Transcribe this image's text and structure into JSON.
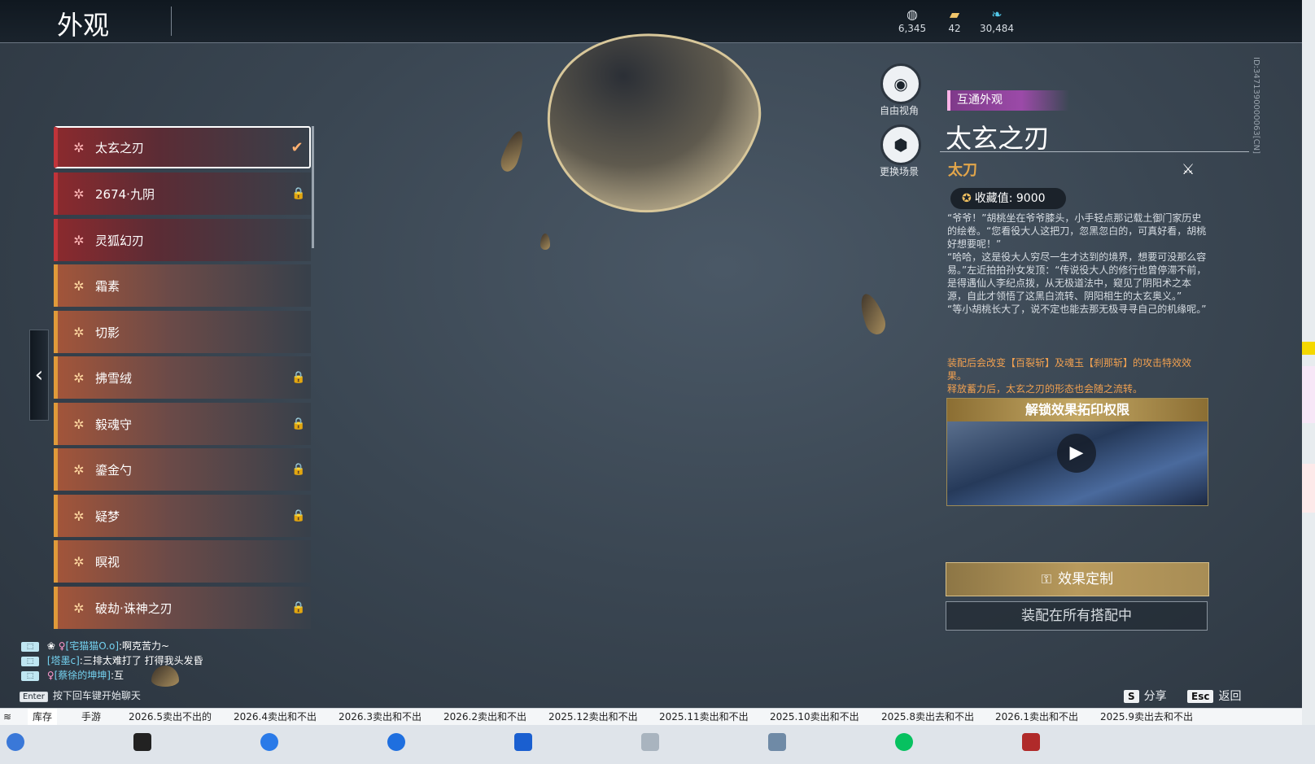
{
  "header": {
    "title": "外观",
    "currencies": [
      {
        "icon": "token-icon",
        "value": "6,345"
      },
      {
        "icon": "ticket-icon",
        "value": "42"
      },
      {
        "icon": "feather-icon",
        "value": "30,484"
      }
    ]
  },
  "list": {
    "items": [
      {
        "label": "太玄之刃",
        "rarity": "red",
        "selected": true,
        "locked": false
      },
      {
        "label": "2674·九阴",
        "rarity": "red",
        "selected": false,
        "locked": true
      },
      {
        "label": "灵狐幻刃",
        "rarity": "red",
        "selected": false,
        "locked": false
      },
      {
        "label": "霜素",
        "rarity": "orange",
        "selected": false,
        "locked": false
      },
      {
        "label": "切影",
        "rarity": "orange",
        "selected": false,
        "locked": false
      },
      {
        "label": "拂雪绒",
        "rarity": "orange",
        "selected": false,
        "locked": true
      },
      {
        "label": "毅魂守",
        "rarity": "orange",
        "selected": false,
        "locked": true
      },
      {
        "label": "鎏金勺",
        "rarity": "orange",
        "selected": false,
        "locked": true
      },
      {
        "label": "疑梦",
        "rarity": "orange",
        "selected": false,
        "locked": true
      },
      {
        "label": "瞑视",
        "rarity": "orange",
        "selected": false,
        "locked": false
      },
      {
        "label": "破劫·诛神之刃",
        "rarity": "orange",
        "selected": false,
        "locked": true
      }
    ]
  },
  "camera": {
    "free_view": "自由视角",
    "change_scene": "更换场景"
  },
  "detail": {
    "tag": "互通外观",
    "name": "太玄之刃",
    "weapon_type": "太刀",
    "collect_label": "收藏值: 9000",
    "description": "“爷爷！”胡桃坐在爷爷膝头，小手轻点那记载土御门家历史的绘卷。“您看役大人这把刀，忽黑忽白的，可真好看，胡桃好想要呢！”\n“哈哈，这是役大人穷尽一生才达到的境界，想要可没那么容易。”左近拍拍孙女发顶：“传说役大人的修行也曾停滞不前，是得遇仙人李纪点拨，从无极道法中，窥见了阴阳术之本源，自此才领悟了这黑白流转、阴阳相生的太玄奥义。”\n“等小胡桃长大了，说不定也能去那无极寻寻自己的机缘呢。”",
    "effect": "装配后会改变【百裂斩】及魂玉【刹那斩】的攻击特效效果。\n释放蓄力后，太玄之刃的形态也会随之流转。",
    "unlock_title": "解锁效果拓印权限",
    "customize_button": "效果定制",
    "equip_button": "装配在所有搭配中",
    "id_text": "ID:3471390000063[CN]"
  },
  "chat": {
    "lines": [
      {
        "channel": "队伍",
        "name": "[宅猫猫O.o]",
        "text": ":啊克苦力~",
        "female": true
      },
      {
        "channel": "队伍",
        "name": "[塔墨c]",
        "text": ":三排太难打了 打得我头发昏",
        "female": false
      },
      {
        "channel": "队伍",
        "name": "[蔡徐的坤坤]",
        "text": ":互",
        "female": true
      }
    ],
    "enter_key": "Enter",
    "enter_hint": "按下回车键开始聊天"
  },
  "hints": {
    "share_key": "S",
    "share_label": "分享",
    "back_key": "Esc",
    "back_label": "返回"
  },
  "sheet_tabs": [
    "库存",
    "手游",
    "2026.5卖出不出的",
    "2026.4卖出和不出",
    "2026.3卖出和不出",
    "2026.2卖出和不出",
    "2025.12卖出和不出",
    "2025.11卖出和不出",
    "2025.10卖出和不出",
    "2025.8卖出去和不出",
    "2026.1卖出和不出",
    "2025.9卖出去和不出"
  ]
}
